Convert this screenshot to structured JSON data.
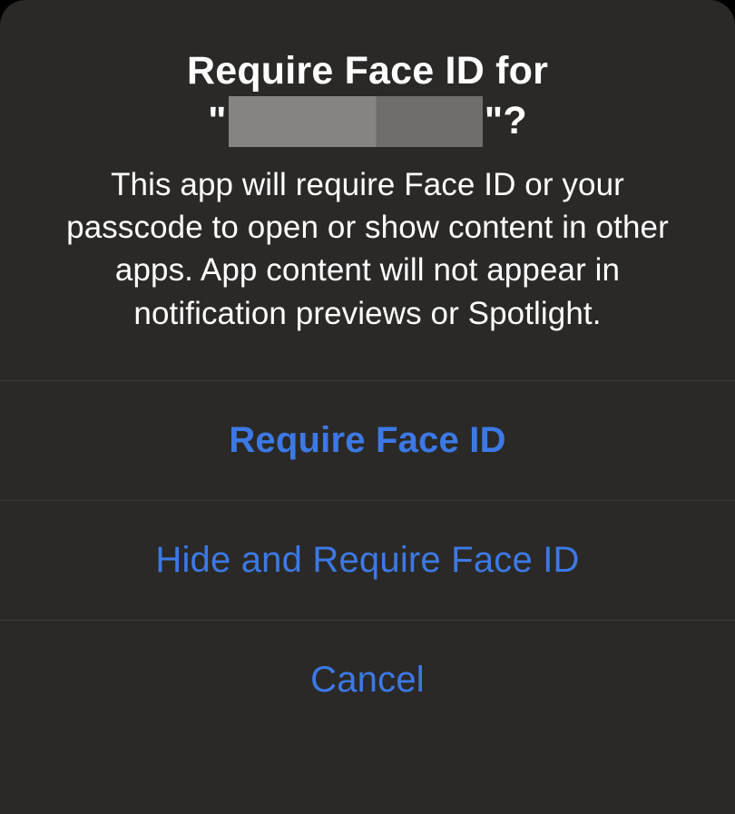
{
  "alert": {
    "title_prefix": "Require Face ID for",
    "quote_open": "\"",
    "quote_close": "\"",
    "question_mark": "?",
    "message": "This app will require Face ID or your passcode to open or show content in other apps. App content will not appear in notification previews or Spotlight.",
    "buttons": {
      "require": "Require Face ID",
      "hide_and_require": "Hide and Require Face ID",
      "cancel": "Cancel"
    }
  }
}
